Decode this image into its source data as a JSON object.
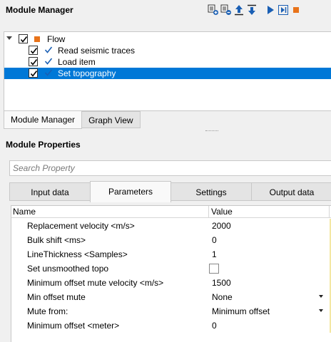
{
  "module_manager": {
    "title": "Module Manager",
    "toolbar": [
      {
        "icon": "add-module-icon",
        "label": ""
      },
      {
        "icon": "remove-module-icon",
        "label": ""
      },
      {
        "icon": "move-up-icon",
        "label": ""
      },
      {
        "icon": "move-down-icon",
        "label": ""
      },
      {
        "icon": "run-icon",
        "label": ""
      },
      {
        "icon": "run-step-icon",
        "label": ""
      },
      {
        "icon": "stop-icon",
        "label": ""
      }
    ],
    "tree": {
      "root": {
        "label": "Flow",
        "checked": true,
        "icon_color": "#e8731a"
      },
      "items": [
        {
          "label": "Read seismic traces",
          "checked": true,
          "selected": false
        },
        {
          "label": "Load item",
          "checked": true,
          "selected": false
        },
        {
          "label": "Set topography",
          "checked": true,
          "selected": true
        }
      ]
    },
    "tabs": [
      {
        "label": "Module Manager",
        "active": true
      },
      {
        "label": "Graph View",
        "active": false
      }
    ]
  },
  "module_properties": {
    "title": "Module Properties",
    "search_placeholder": "Search Property",
    "tabs": [
      {
        "label": "Input data",
        "active": false
      },
      {
        "label": "Parameters",
        "active": true
      },
      {
        "label": "Settings",
        "active": false
      },
      {
        "label": "Output data",
        "active": false
      }
    ],
    "grid": {
      "columns": [
        "Name",
        "Value"
      ],
      "rows": [
        {
          "name": "Replacement velocity <m/s>",
          "value": "2000",
          "type": "text"
        },
        {
          "name": "Bulk shift <ms>",
          "value": "0",
          "type": "text"
        },
        {
          "name": "LineThickness <Samples>",
          "value": "1",
          "type": "text"
        },
        {
          "name": "Set unsmoothed topo",
          "value": "",
          "type": "checkbox",
          "checked": false
        },
        {
          "name": "Minimum offset mute velocity <m/s>",
          "value": "1500",
          "type": "text"
        },
        {
          "name": "Min offset mute",
          "value": "None",
          "type": "dropdown"
        },
        {
          "name": "Mute from:",
          "value": "Minimum offset",
          "type": "dropdown"
        },
        {
          "name": "Minimum offset <meter>",
          "value": "0",
          "type": "text"
        }
      ]
    }
  },
  "colors": {
    "selection": "#0078d7",
    "accent_blue": "#1a5fb4",
    "stop_orange": "#e8731a",
    "edge_yellow": "#f4e7a3"
  }
}
